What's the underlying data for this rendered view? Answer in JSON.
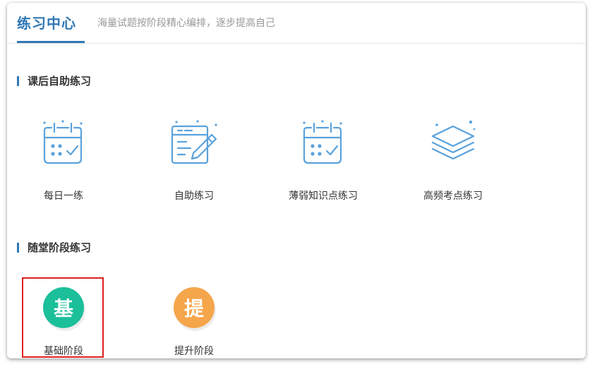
{
  "header": {
    "title": "练习中心",
    "subtitle": "海量试题按阶段精心编排，逐步提高自己"
  },
  "sections": [
    {
      "title": "课后自助练习",
      "items": [
        {
          "label": "每日一练",
          "icon": "calendar-check-icon"
        },
        {
          "label": "自助练习",
          "icon": "form-pen-icon"
        },
        {
          "label": "薄弱知识点练习",
          "icon": "calendar-check-icon"
        },
        {
          "label": "高频考点练习",
          "icon": "layers-icon"
        }
      ]
    },
    {
      "title": "随堂阶段练习",
      "items": [
        {
          "label": "基础阶段",
          "badge": "基",
          "color": "#1bbf9a"
        },
        {
          "label": "提升阶段",
          "badge": "提",
          "color": "#f5a54a"
        }
      ]
    }
  ],
  "colors": {
    "accent": "#2f78b5",
    "icon_line": "#5aa2dc",
    "highlight": "#e02020"
  }
}
